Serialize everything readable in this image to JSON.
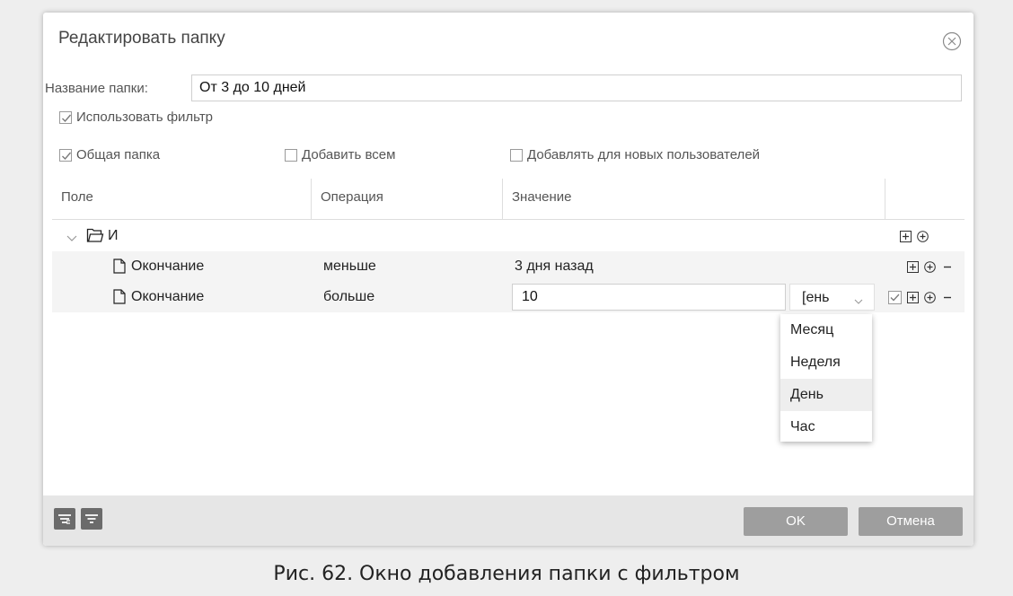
{
  "dialog": {
    "title": "Редактировать папку",
    "folder_name_label": "Название папки:",
    "folder_name_value": "От 3 до 10 дней",
    "use_filter_label": "Использовать фильтр",
    "use_filter_checked": true,
    "shared_folder_label": "Общая папка",
    "shared_folder_checked": true,
    "add_to_all_label": "Добавить всем",
    "add_to_all_checked": false,
    "add_new_users_label": "Добавлять для новых пользователей",
    "add_new_users_checked": false
  },
  "grid": {
    "columns": [
      "Поле",
      "Операция",
      "Значение"
    ],
    "group_label": "И",
    "rows": [
      {
        "field": "Окончание",
        "operation": "меньше",
        "value": "3 дня назад"
      },
      {
        "field": "Окончание",
        "operation": "больше",
        "value": "10",
        "unit": "[ень",
        "unit_checked": true
      }
    ],
    "unit_options": [
      "Месяц",
      "Неделя",
      "День",
      "Час"
    ],
    "selected_unit": "День"
  },
  "footer": {
    "ok_label": "OK",
    "cancel_label": "Отмена"
  },
  "icons": {
    "close": "close-circle-icon",
    "expand": "chevron-down-icon",
    "folder": "folder-icon",
    "document": "document-icon",
    "add_group": "add-group-icon",
    "add_condition": "add-circle-icon",
    "remove": "minus-icon",
    "filter_tree": "filter-tree-icon",
    "filter": "filter-icon"
  },
  "caption": "Рис. 62. Окно добавления папки с фильтром",
  "colors": {
    "footer_bg": "#e6e6e6",
    "button_bg": "#9e9e9e",
    "icon_button_bg": "#6b6b6b",
    "row_alt_bg": "#f4f4f4"
  }
}
